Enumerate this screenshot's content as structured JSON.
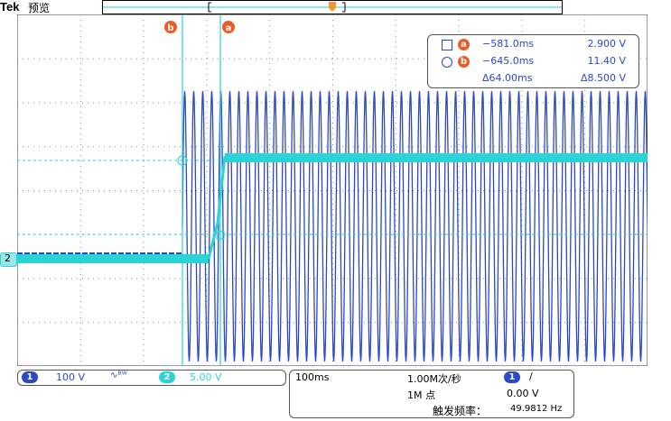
{
  "header": {
    "brand": "Tek",
    "mode": "预览"
  },
  "cursors": {
    "a": {
      "letter": "a",
      "time": "−581.0ms",
      "volt": "2.900 V"
    },
    "b": {
      "letter": "b",
      "time": "−645.0ms",
      "volt": "11.40 V"
    },
    "delta": {
      "time": "Δ64.00ms",
      "volt": "Δ8.500 V"
    }
  },
  "channels": {
    "ch1": {
      "num": "1",
      "scale": "100 V",
      "bw_symbol": "∿ᴮᵂ",
      "color": "#2b49c5"
    },
    "ch2": {
      "num": "2",
      "scale": "5.00 V",
      "color": "#2ad4d6"
    }
  },
  "ch2_marker": "2",
  "timebase": {
    "scale": "100ms",
    "sample_rate": "1.00M次/秒",
    "record_length": "1M 点",
    "trigger_channel": "1",
    "trigger_slope": "∕",
    "trigger_level": "0.00 V",
    "freq_label": "触发频率：",
    "freq_value": "49.9812 Hz"
  },
  "colors": {
    "ch1": "#2b49c5",
    "ch2": "#2ad4d6",
    "cursor": "#ee5a24",
    "trigger": "#f29a2e"
  }
}
